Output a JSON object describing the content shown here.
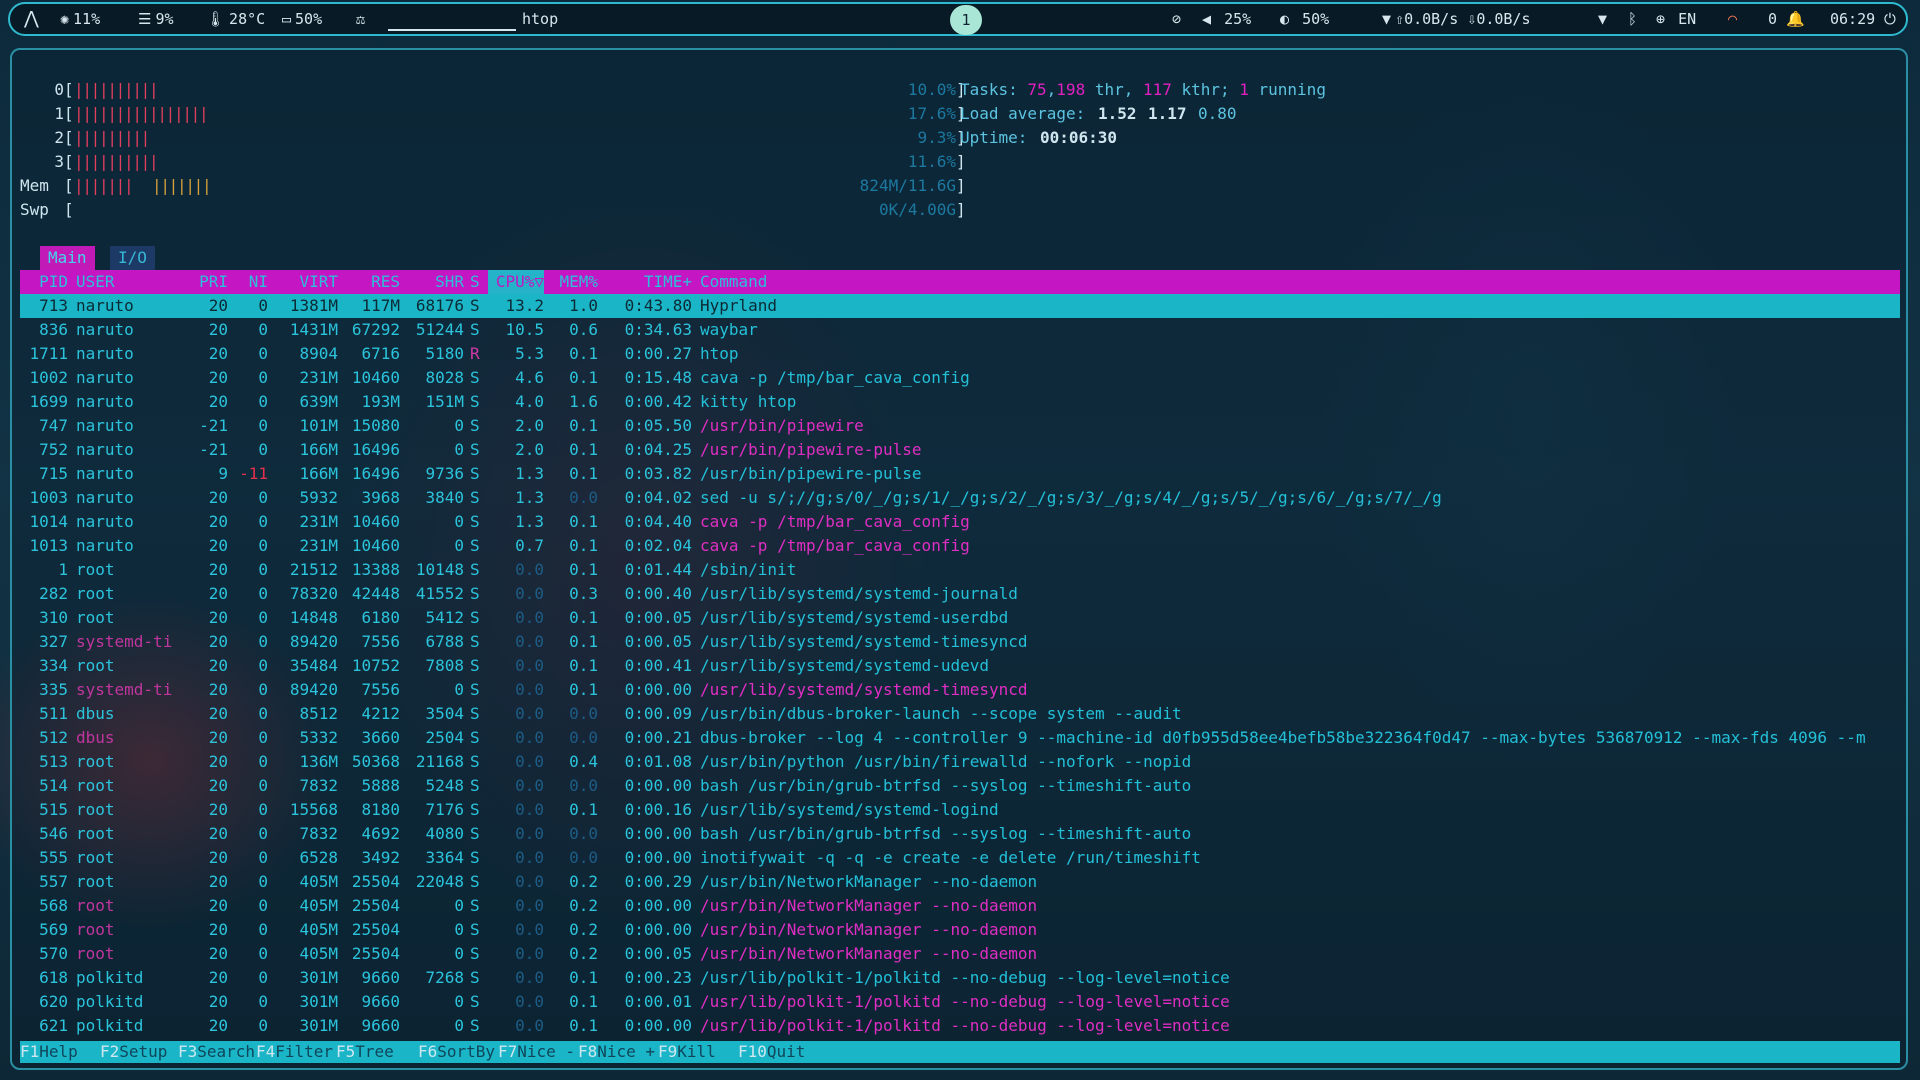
{
  "topbar": {
    "cpu": "11%",
    "mem": "9%",
    "temp": "28°C",
    "battery": "50%",
    "window_title": "htop",
    "workspace": "1",
    "volume": "25%",
    "brightness": "50%",
    "net_down": "0.0B/s",
    "net_up": "0.0B/s",
    "lang": "EN",
    "notifications": "0",
    "clock": "06:29"
  },
  "meters": {
    "cpus": [
      {
        "id": "0",
        "bar": "||||||||||",
        "pct": "10.0%"
      },
      {
        "id": "1",
        "bar": "||||||||||||||||",
        "pct": "17.6%"
      },
      {
        "id": "2",
        "bar": "|||||||||",
        "pct": "9.3%"
      },
      {
        "id": "3",
        "bar": "||||||||||",
        "pct": "11.6%"
      }
    ],
    "mem": {
      "label": "Mem",
      "bar_a": "|||||||",
      "bar_b": "|||||||",
      "value": "824M/11.6G"
    },
    "swp": {
      "label": "Swp",
      "value": "0K/4.00G"
    },
    "tasks": {
      "label": "Tasks:",
      "tasks": "75",
      "thr": "198",
      "thr_label": "thr,",
      "kthr": "117",
      "kthr_label": "kthr;",
      "running": "1",
      "running_label": "running"
    },
    "load": {
      "label": "Load average:",
      "one": "1.52",
      "five": "1.17",
      "fifteen": "0.80"
    },
    "uptime": {
      "label": "Uptime:",
      "value": "00:06:30"
    }
  },
  "tabs": [
    "Main",
    "I/O"
  ],
  "columns": [
    "PID",
    "USER",
    "PRI",
    "NI",
    "VIRT",
    "RES",
    "SHR",
    "S",
    "CPU%▽",
    "MEM%",
    "TIME+",
    "Command"
  ],
  "processes": [
    [
      "713",
      "naruto",
      "20",
      "0",
      "1381M",
      "117M",
      "68176",
      "S",
      "13.2",
      "1.0",
      "0:43.80",
      "Hyprland"
    ],
    [
      "836",
      "naruto",
      "20",
      "0",
      "1431M",
      "67292",
      "51244",
      "S",
      "10.5",
      "0.6",
      "0:34.63",
      "waybar"
    ],
    [
      "1711",
      "naruto",
      "20",
      "0",
      "8904",
      "6716",
      "5180",
      "R",
      "5.3",
      "0.1",
      "0:00.27",
      "htop"
    ],
    [
      "1002",
      "naruto",
      "20",
      "0",
      "231M",
      "10460",
      "8028",
      "S",
      "4.6",
      "0.1",
      "0:15.48",
      "cava -p /tmp/bar_cava_config"
    ],
    [
      "1699",
      "naruto",
      "20",
      "0",
      "639M",
      "193M",
      "151M",
      "S",
      "4.0",
      "1.6",
      "0:00.42",
      "kitty htop"
    ],
    [
      "747",
      "naruto",
      "-21",
      "0",
      "101M",
      "15080",
      "0",
      "S",
      "2.0",
      "0.1",
      "0:05.50",
      "/usr/bin/pipewire"
    ],
    [
      "752",
      "naruto",
      "-21",
      "0",
      "166M",
      "16496",
      "0",
      "S",
      "2.0",
      "0.1",
      "0:04.25",
      "/usr/bin/pipewire-pulse"
    ],
    [
      "715",
      "naruto",
      "9",
      "-11",
      "166M",
      "16496",
      "9736",
      "S",
      "1.3",
      "0.1",
      "0:03.82",
      "/usr/bin/pipewire-pulse"
    ],
    [
      "1003",
      "naruto",
      "20",
      "0",
      "5932",
      "3968",
      "3840",
      "S",
      "1.3",
      "0.0",
      "0:04.02",
      "sed -u s/;//g;s/0/_/g;s/1/_/g;s/2/_/g;s/3/_/g;s/4/_/g;s/5/_/g;s/6/_/g;s/7/_/g"
    ],
    [
      "1014",
      "naruto",
      "20",
      "0",
      "231M",
      "10460",
      "0",
      "S",
      "1.3",
      "0.1",
      "0:04.40",
      "cava -p /tmp/bar_cava_config"
    ],
    [
      "1013",
      "naruto",
      "20",
      "0",
      "231M",
      "10460",
      "0",
      "S",
      "0.7",
      "0.1",
      "0:02.04",
      "cava -p /tmp/bar_cava_config"
    ],
    [
      "1",
      "root",
      "20",
      "0",
      "21512",
      "13388",
      "10148",
      "S",
      "0.0",
      "0.1",
      "0:01.44",
      "/sbin/init"
    ],
    [
      "282",
      "root",
      "20",
      "0",
      "78320",
      "42448",
      "41552",
      "S",
      "0.0",
      "0.3",
      "0:00.40",
      "/usr/lib/systemd/systemd-journald"
    ],
    [
      "310",
      "root",
      "20",
      "0",
      "14848",
      "6180",
      "5412",
      "S",
      "0.0",
      "0.1",
      "0:00.05",
      "/usr/lib/systemd/systemd-userdbd"
    ],
    [
      "327",
      "systemd-ti",
      "20",
      "0",
      "89420",
      "7556",
      "6788",
      "S",
      "0.0",
      "0.1",
      "0:00.05",
      "/usr/lib/systemd/systemd-timesyncd"
    ],
    [
      "334",
      "root",
      "20",
      "0",
      "35484",
      "10752",
      "7808",
      "S",
      "0.0",
      "0.1",
      "0:00.41",
      "/usr/lib/systemd/systemd-udevd"
    ],
    [
      "335",
      "systemd-ti",
      "20",
      "0",
      "89420",
      "7556",
      "0",
      "S",
      "0.0",
      "0.1",
      "0:00.00",
      "/usr/lib/systemd/systemd-timesyncd"
    ],
    [
      "511",
      "dbus",
      "20",
      "0",
      "8512",
      "4212",
      "3504",
      "S",
      "0.0",
      "0.0",
      "0:00.09",
      "/usr/bin/dbus-broker-launch --scope system --audit"
    ],
    [
      "512",
      "dbus",
      "20",
      "0",
      "5332",
      "3660",
      "2504",
      "S",
      "0.0",
      "0.0",
      "0:00.21",
      "dbus-broker --log 4 --controller 9 --machine-id d0fb955d58ee4befb58be322364f0d47 --max-bytes 536870912 --max-fds 4096 --m"
    ],
    [
      "513",
      "root",
      "20",
      "0",
      "136M",
      "50368",
      "21168",
      "S",
      "0.0",
      "0.4",
      "0:01.08",
      "/usr/bin/python /usr/bin/firewalld --nofork --nopid"
    ],
    [
      "514",
      "root",
      "20",
      "0",
      "7832",
      "5888",
      "5248",
      "S",
      "0.0",
      "0.0",
      "0:00.00",
      "bash /usr/bin/grub-btrfsd --syslog --timeshift-auto"
    ],
    [
      "515",
      "root",
      "20",
      "0",
      "15568",
      "8180",
      "7176",
      "S",
      "0.0",
      "0.1",
      "0:00.16",
      "/usr/lib/systemd/systemd-logind"
    ],
    [
      "546",
      "root",
      "20",
      "0",
      "7832",
      "4692",
      "4080",
      "S",
      "0.0",
      "0.0",
      "0:00.00",
      "bash /usr/bin/grub-btrfsd --syslog --timeshift-auto"
    ],
    [
      "555",
      "root",
      "20",
      "0",
      "6528",
      "3492",
      "3364",
      "S",
      "0.0",
      "0.0",
      "0:00.00",
      "inotifywait -q -q -e create -e delete /run/timeshift"
    ],
    [
      "557",
      "root",
      "20",
      "0",
      "405M",
      "25504",
      "22048",
      "S",
      "0.0",
      "0.2",
      "0:00.29",
      "/usr/bin/NetworkManager --no-daemon"
    ],
    [
      "568",
      "root",
      "20",
      "0",
      "405M",
      "25504",
      "0",
      "S",
      "0.0",
      "0.2",
      "0:00.00",
      "/usr/bin/NetworkManager --no-daemon"
    ],
    [
      "569",
      "root",
      "20",
      "0",
      "405M",
      "25504",
      "0",
      "S",
      "0.0",
      "0.2",
      "0:00.00",
      "/usr/bin/NetworkManager --no-daemon"
    ],
    [
      "570",
      "root",
      "20",
      "0",
      "405M",
      "25504",
      "0",
      "S",
      "0.0",
      "0.2",
      "0:00.05",
      "/usr/bin/NetworkManager --no-daemon"
    ],
    [
      "618",
      "polkitd",
      "20",
      "0",
      "301M",
      "9660",
      "7268",
      "S",
      "0.0",
      "0.1",
      "0:00.23",
      "/usr/lib/polkit-1/polkitd --no-debug --log-level=notice"
    ],
    [
      "620",
      "polkitd",
      "20",
      "0",
      "301M",
      "9660",
      "0",
      "S",
      "0.0",
      "0.1",
      "0:00.01",
      "/usr/lib/polkit-1/polkitd --no-debug --log-level=notice"
    ],
    [
      "621",
      "polkitd",
      "20",
      "0",
      "301M",
      "9660",
      "0",
      "S",
      "0.0",
      "0.1",
      "0:00.00",
      "/usr/lib/polkit-1/polkitd --no-debug --log-level=notice"
    ]
  ],
  "footer": [
    {
      "key": "F1",
      "label": "Help"
    },
    {
      "key": "F2",
      "label": "Setup"
    },
    {
      "key": "F3",
      "label": "Search"
    },
    {
      "key": "F4",
      "label": "Filter"
    },
    {
      "key": "F5",
      "label": "Tree"
    },
    {
      "key": "F6",
      "label": "SortBy"
    },
    {
      "key": "F7",
      "label": "Nice -"
    },
    {
      "key": "F8",
      "label": "Nice +"
    },
    {
      "key": "F9",
      "label": "Kill"
    },
    {
      "key": "F10",
      "label": "Quit"
    }
  ]
}
